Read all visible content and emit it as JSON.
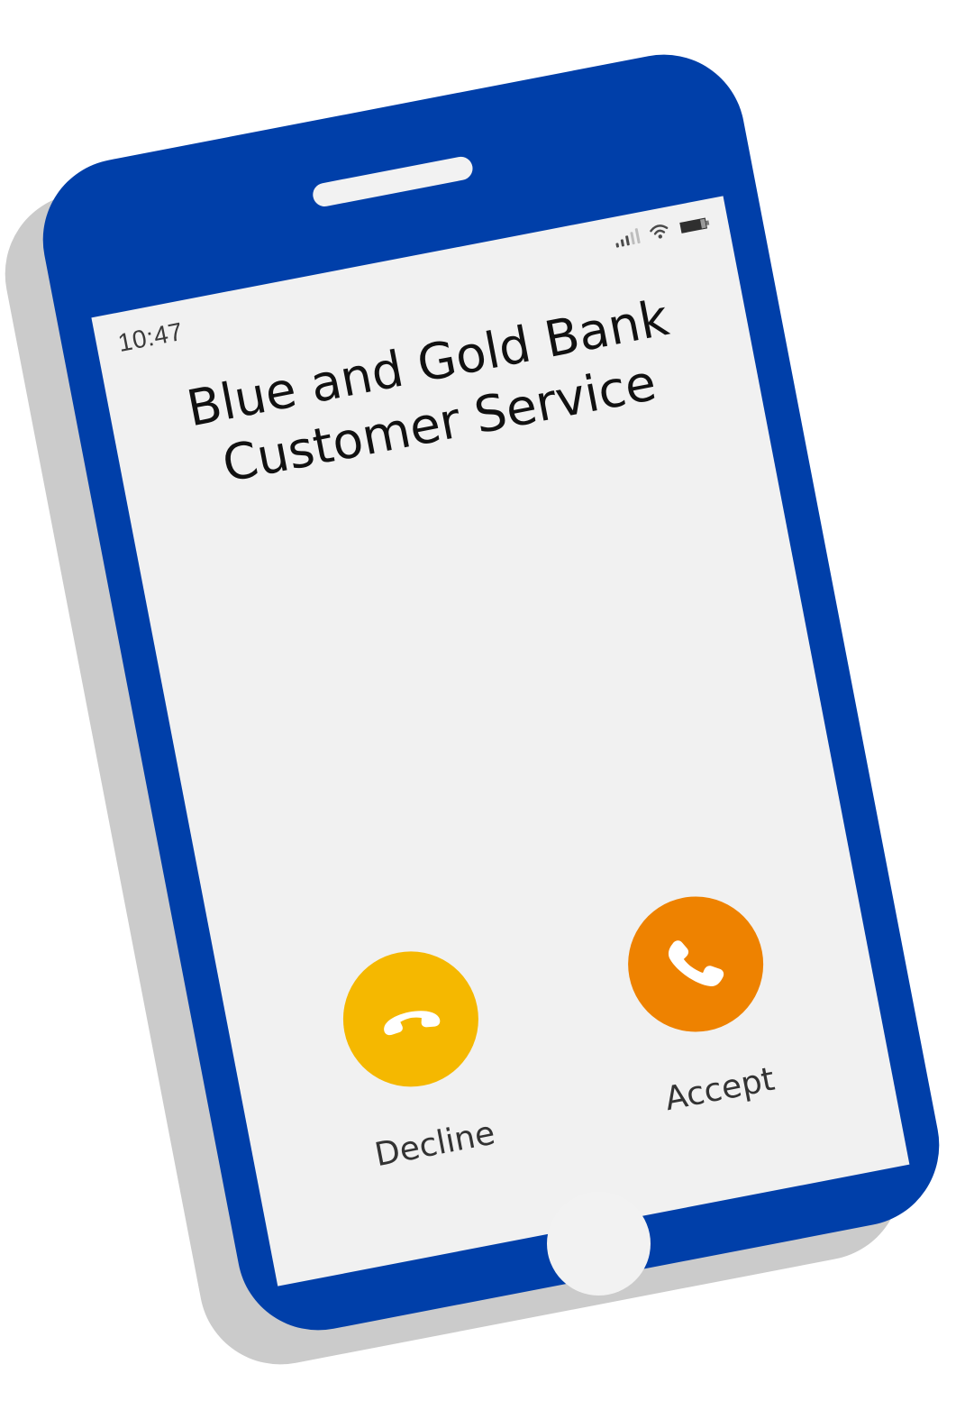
{
  "status_bar": {
    "time": "10:47",
    "signal_icon": "cellular-signal-icon",
    "wifi_icon": "wifi-icon",
    "battery_icon": "battery-icon"
  },
  "call": {
    "caller_line1": "Blue and Gold Bank",
    "caller_line2": "Customer Service"
  },
  "actions": {
    "decline_label": "Decline",
    "accept_label": "Accept",
    "decline_icon": "hang-up-phone-icon",
    "accept_icon": "phone-handset-icon"
  },
  "colors": {
    "phone_body": "#003fa9",
    "screen": "#f1f1f1",
    "decline_button": "#f5b800",
    "accept_button": "#ee8200",
    "shadow": "#cbcbcb"
  }
}
